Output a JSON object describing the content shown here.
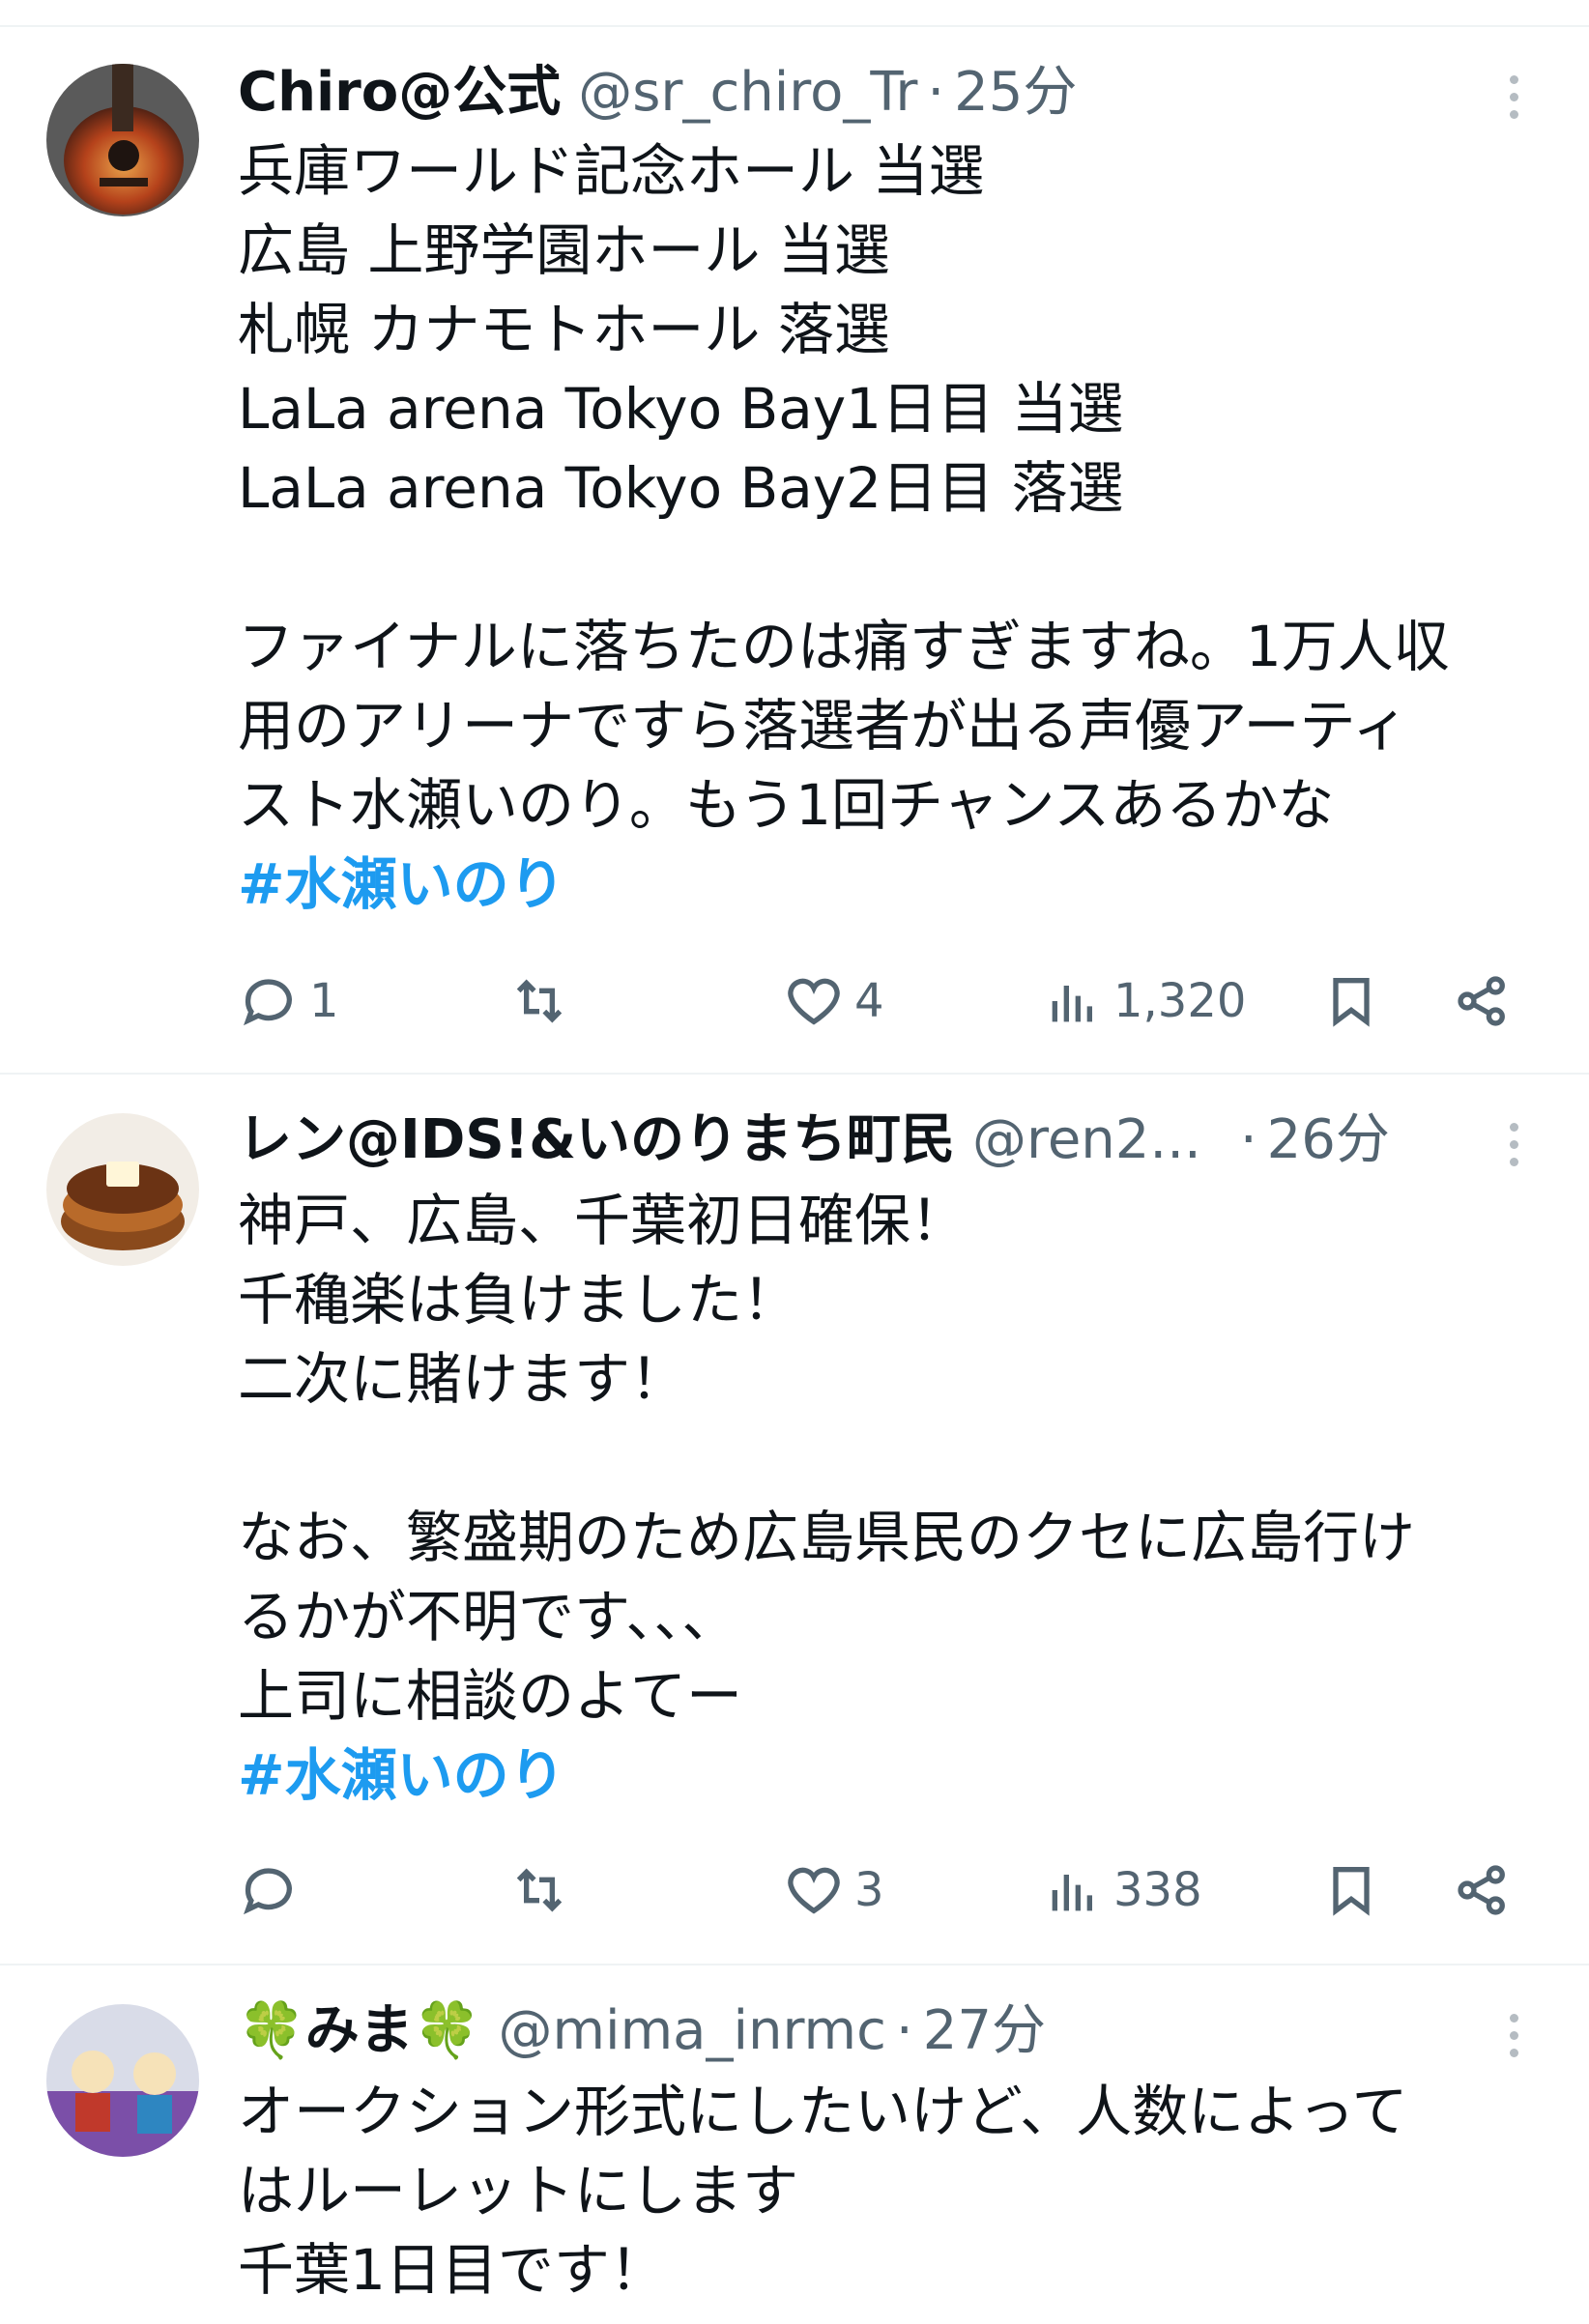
{
  "tweets": [
    {
      "name": "Chiro@公式",
      "handle": "@sr_chiro_Tr",
      "time": "25分",
      "lines": [
        "兵庫ワールド記念ホール 当選",
        "広島 上野学園ホール 当選",
        "札幌 カナモトホール 落選",
        "LaLa arena Tokyo Bay1日目 当選",
        "LaLa arena Tokyo Bay2日目 落選",
        "",
        "ファイナルに落ちたのは痛すぎますね。1万人収",
        "用のアリーナですら落選者が出る声優アーティ",
        "スト水瀬いのり。もう1回チャンスあるかな"
      ],
      "hashtag": "#水瀬いのり",
      "replies": "1",
      "retweets": "",
      "likes": "4",
      "views": "1,320"
    },
    {
      "name": "レン@IDS!&いのりまち町民",
      "handle": "@ren2...",
      "time": "26分",
      "lines": [
        "神戸、広島、千葉初日確保！",
        "千穐楽は負けました！",
        "二次に賭けます！",
        "",
        "なお、繁盛期のため広島県民のクセに広島行け",
        "るかが不明です、、、",
        "上司に相談のよてー"
      ],
      "hashtag": "#水瀬いのり",
      "replies": "",
      "retweets": "",
      "likes": "3",
      "views": "338"
    },
    {
      "name_prefix": "🍀",
      "name": "みま",
      "name_suffix": "🍀",
      "handle": "@mima_inrmc",
      "time": "27分",
      "lines": [
        "オークション形式にしたいけど、人数によって",
        "はルーレットにします",
        "千葉1日目です！"
      ]
    }
  ]
}
